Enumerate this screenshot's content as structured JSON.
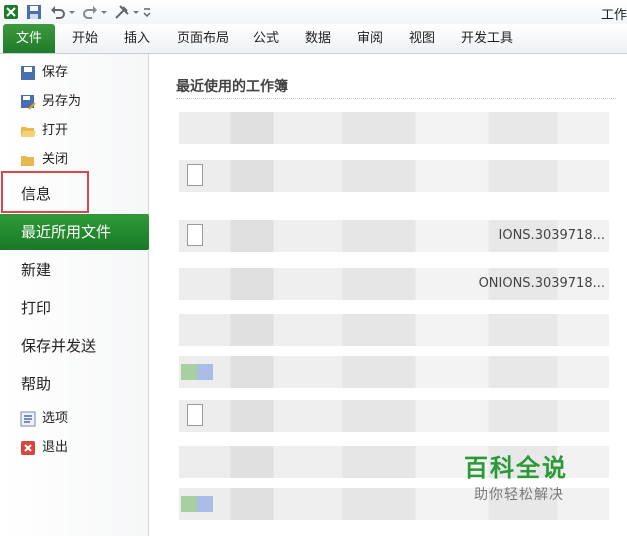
{
  "app": {
    "title_fragment": "工作"
  },
  "ribbon": {
    "tabs": [
      {
        "label": "文件"
      },
      {
        "label": "开始"
      },
      {
        "label": "插入"
      },
      {
        "label": "页面布局"
      },
      {
        "label": "公式"
      },
      {
        "label": "数据"
      },
      {
        "label": "审阅"
      },
      {
        "label": "视图"
      },
      {
        "label": "开发工具"
      }
    ]
  },
  "backstage": {
    "small_items": [
      {
        "label": "保存",
        "icon": "save-icon"
      },
      {
        "label": "另存为",
        "icon": "save-as-icon"
      },
      {
        "label": "打开",
        "icon": "open-folder-icon"
      },
      {
        "label": "关闭",
        "icon": "close-folder-icon"
      }
    ],
    "big_items": [
      {
        "label": "信息"
      },
      {
        "label": "最近所用文件",
        "active": true
      },
      {
        "label": "新建"
      },
      {
        "label": "打印"
      },
      {
        "label": "保存并发送"
      },
      {
        "label": "帮助"
      }
    ],
    "bottom_items": [
      {
        "label": "选项",
        "icon": "options-icon"
      },
      {
        "label": "退出",
        "icon": "exit-icon"
      }
    ]
  },
  "main": {
    "section_title": "最近使用的工作簿",
    "rows": [
      {
        "text": ""
      },
      {
        "text": ""
      },
      {
        "text": "IONS.3039718..."
      },
      {
        "text": "ONIONS.3039718..."
      },
      {
        "text": ""
      },
      {
        "text": ""
      },
      {
        "text": ""
      },
      {
        "text": ""
      },
      {
        "text": ""
      }
    ]
  },
  "watermark": {
    "main": "百科全说",
    "sub": "助你轻松解决"
  },
  "colors": {
    "accent": "#1f7a2a",
    "highlight_box": "#e0454c"
  }
}
